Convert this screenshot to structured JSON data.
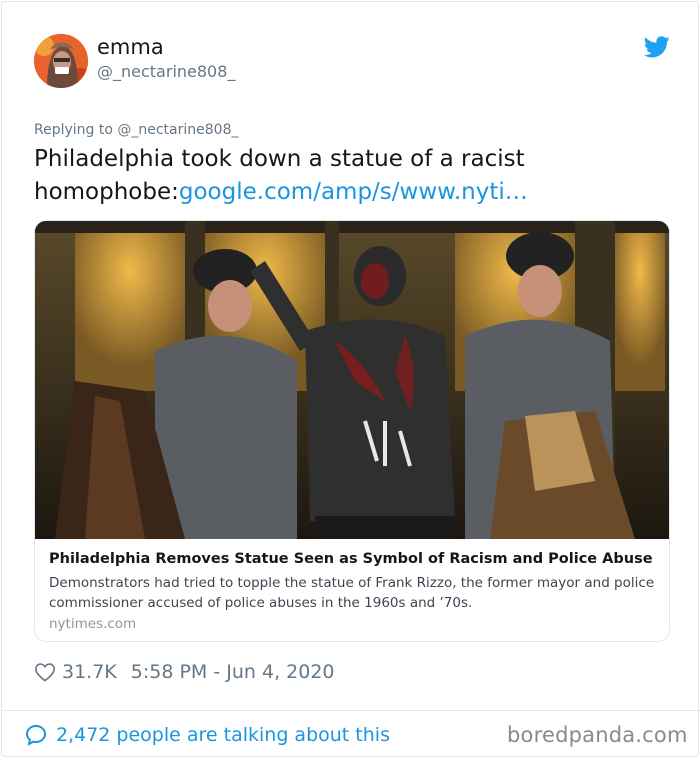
{
  "user": {
    "display_name": "emma",
    "handle": "@_nectarine808_"
  },
  "tweet": {
    "replying_to": "Replying to @_nectarine808_",
    "text": "Philadelphia took down a statue of a racist homophobe:",
    "link_text": "google.com/amp/s/www.nyti…"
  },
  "link_card": {
    "title": "Philadelphia Removes Statue Seen as Symbol of Racism and Police Abuse",
    "description": "Demonstrators had tried to topple the statue of Frank Rizzo, the former mayor and police commissioner accused of police abuses in the 1960s and ’70s.",
    "domain": "nytimes.com"
  },
  "meta": {
    "likes": "31.7K",
    "timestamp": "5:58 PM - Jun 4, 2020"
  },
  "footer": {
    "talking": "2,472 people are talking about this",
    "watermark": "boredpanda.com"
  },
  "icons": {
    "brand": "twitter-bird-icon",
    "like": "heart-icon",
    "talking": "comment-bubble-icon"
  },
  "colors": {
    "link_blue": "#1b95e0",
    "secondary_text": "#657786",
    "border": "#e1e8ed"
  }
}
